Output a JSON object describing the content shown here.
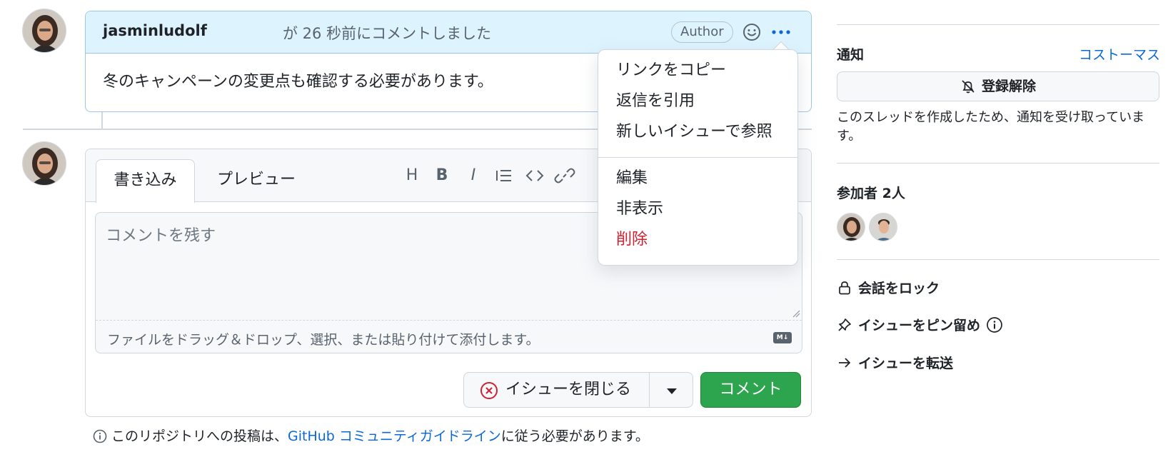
{
  "comment": {
    "author": "jasminludolf",
    "time_text": "が 26 秒前にコメントしました",
    "badge": "Author",
    "body": "冬のキャンペーンの変更点も確認する必要があります。"
  },
  "menu": {
    "items": [
      "リンクをコピー",
      "返信を引用",
      "新しいイシューで参照",
      "編集",
      "非表示",
      "削除"
    ]
  },
  "editor": {
    "tab_write": "書き込み",
    "tab_preview": "プレビュー",
    "toolbar_icons": [
      "heading-icon",
      "bold-icon",
      "italic-icon",
      "list-icon",
      "code-icon",
      "link-icon"
    ],
    "placeholder": "コメントを残す",
    "attach_text": "ファイルをドラッグ＆ドロップ、選択、または貼り付けて添付します。",
    "md_badge": "M↓",
    "close_issue_label": "イシューを閉じる",
    "submit_label": "コメント"
  },
  "guidelines": {
    "prefix": "このリポジトリへの投稿は、",
    "link": "GitHub コミュニティガイドライン",
    "suffix": "に従う必要があります。"
  },
  "sidebar": {
    "notifications_heading": "通知",
    "customize": "コストーマス",
    "unsubscribe": "登録解除",
    "notification_note": "このスレッドを作成したため、通知を受け取っています。",
    "participants_heading": "参加者 2人",
    "lock": "会話をロック",
    "pin": "イシューをピン留め",
    "transfer": "イシューを転送"
  },
  "colors": {
    "accent": "#0969da",
    "success": "#2da44e",
    "danger": "#cf222e",
    "header_bg": "#ddf4ff"
  }
}
